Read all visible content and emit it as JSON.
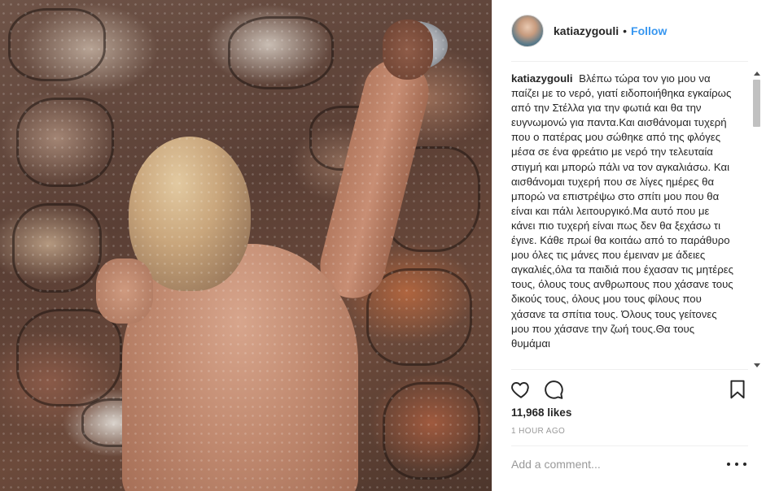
{
  "post": {
    "username": "katiazygouli",
    "separator": "•",
    "follow_label": "Follow",
    "caption_user": "katiazygouli",
    "caption_text": "Βλέπω τώρα τον γιο μου να παίζει με το νερό, γιατί ειδοποιήθηκα εγκαίρως από την Στέλλα για την φωτιά και θα την ευγνωμονώ για παντα.Και αισθάνομαι τυχερή που ο πατέρας μου σώθηκε από της φλόγες μέσα σε ένα φρεάτιο με νερό την τελευταία στιγμή και μπορώ πάλι να τον αγκαλιάσω. Και αισθάνομαι τυχερή που σε λίγες ημέρες θα μπορώ να επιστρέψω στο σπίτι μου που θα είναι και πάλι λειτουργικό.Μα αυτό που με κάνει πιο τυχερή είναι πως δεν θα ξεχάσω τι έγινε. Κάθε πρωί θα κοιτάω από το παράθυρο μου όλες τις μάνες που έμειναν με άδειες αγκαλιές,όλα τα παιδιά που έχασαν τις μητέρες τους, όλους τους ανθρωπους που χάσανε τους δικούς τους, όλους μου τους φίλους που χάσανε τα σπίτια τους. Όλους τους γείτονες μου που χάσανε την ζωή τους.Θα τους θυμάμαι",
    "likes": "11,968 likes",
    "timestamp": "1 HOUR AGO",
    "comment_placeholder": "Add a comment..."
  },
  "icons": {
    "like": "heart-icon",
    "comment": "speech-bubble-icon",
    "save": "bookmark-icon",
    "more": "more-options-icon"
  },
  "colors": {
    "follow": "#3897f0",
    "text": "#262626",
    "muted": "#999999",
    "divider": "#efefef"
  }
}
